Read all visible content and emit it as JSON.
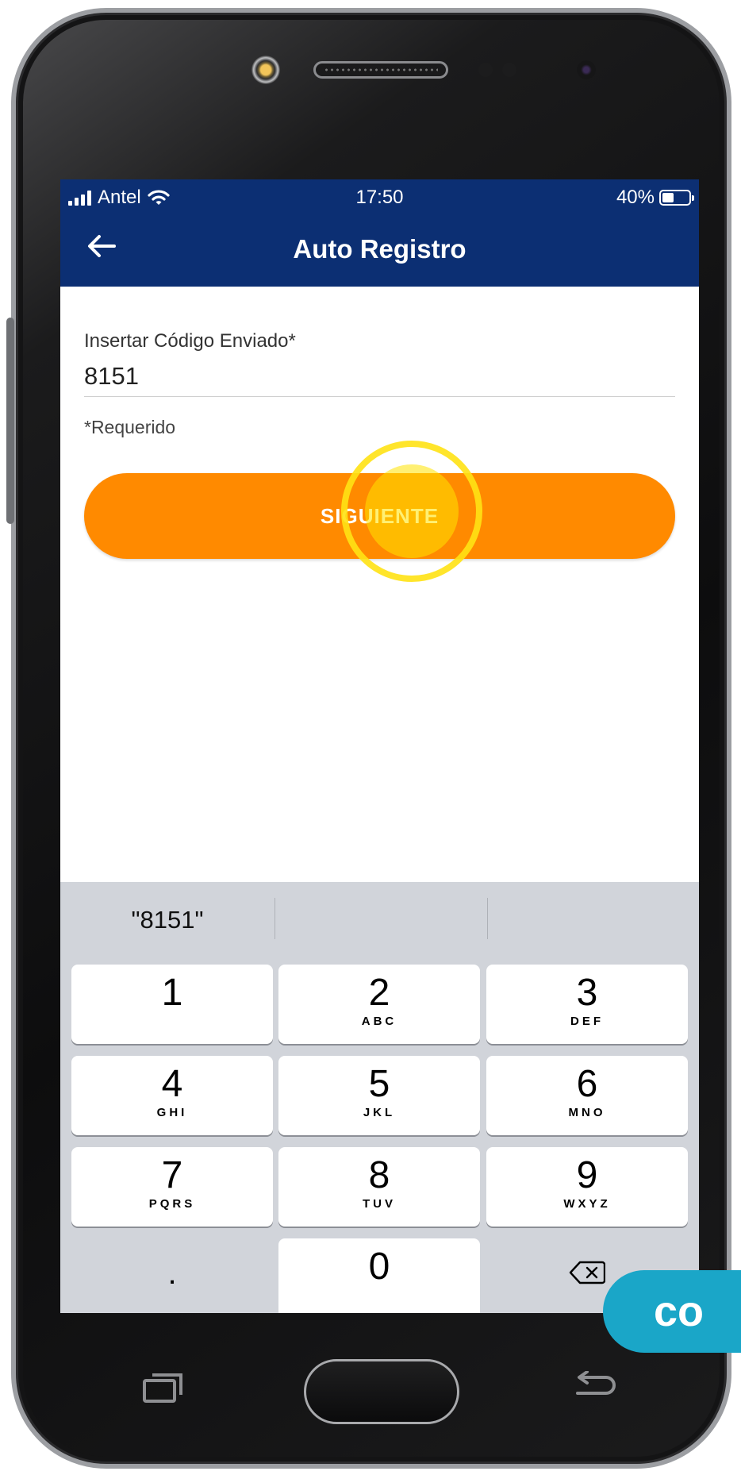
{
  "status_bar": {
    "carrier": "Antel",
    "time": "17:50",
    "battery": "40%"
  },
  "header": {
    "title": "Auto Registro",
    "back_icon": "arrow-left-icon"
  },
  "form": {
    "code_label": "Insertar Código Enviado*",
    "code_value": "8151",
    "required_note": "*Requerido",
    "submit_label": "SIGUIENTE"
  },
  "colors": {
    "header_bg": "#0c2f73",
    "button_bg": "#ff8a00",
    "tap_indicator": "#ffe214",
    "badge_bg": "#1aa6c8"
  },
  "keyboard": {
    "suggestions": [
      "\"8151\"",
      "",
      ""
    ],
    "keys": [
      {
        "num": "1",
        "letters": ""
      },
      {
        "num": "2",
        "letters": "ABC"
      },
      {
        "num": "3",
        "letters": "DEF"
      },
      {
        "num": "4",
        "letters": "GHI"
      },
      {
        "num": "5",
        "letters": "JKL"
      },
      {
        "num": "6",
        "letters": "MNO"
      },
      {
        "num": "7",
        "letters": "PQRS"
      },
      {
        "num": "8",
        "letters": "TUV"
      },
      {
        "num": "9",
        "letters": "WXYZ"
      },
      {
        "num": ".",
        "letters": ""
      },
      {
        "num": "0",
        "letters": ""
      },
      {
        "num": "",
        "letters": "",
        "icon": "delete-backspace-icon"
      }
    ]
  },
  "hardware": {
    "recent_icon": "recent-apps-icon",
    "back_icon": "back-arrow-icon"
  },
  "overlay_badge": "co"
}
